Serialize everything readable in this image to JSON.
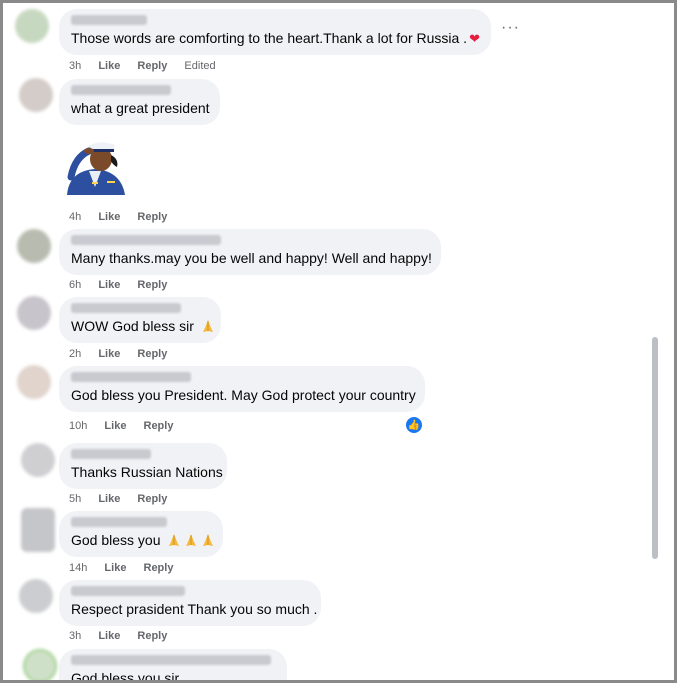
{
  "comments": [
    {
      "text": "Those words are comforting to the heart.Thank a lot for Russia .",
      "emoji": "heart",
      "time": "3h",
      "like": "Like",
      "reply": "Reply",
      "edited": "Edited"
    },
    {
      "text": "what a great president",
      "time": "4h",
      "like": "Like",
      "reply": "Reply",
      "sticker": "saluting-officer-sticker"
    },
    {
      "text": "Many thanks.may you be well and happy! Well and happy!",
      "time": "6h",
      "like": "Like",
      "reply": "Reply"
    },
    {
      "text": "WOW God bless sir",
      "emoji": "praying-hands",
      "time": "2h",
      "like": "Like",
      "reply": "Reply"
    },
    {
      "text": "God bless you President. May God protect your country",
      "time": "10h",
      "like": "Like",
      "reply": "Reply",
      "reaction": "like-reaction-icon"
    },
    {
      "text": "Thanks Russian Nations",
      "time": "5h",
      "like": "Like",
      "reply": "Reply"
    },
    {
      "text": "God bless you",
      "emoji": "praying-hands x3",
      "time": "14h",
      "like": "Like",
      "reply": "Reply"
    },
    {
      "text": "Respect prasident Thank you so much .",
      "time": "3h",
      "like": "Like",
      "reply": "Reply"
    },
    {
      "text": "God bless you sir"
    }
  ],
  "more_options": "···",
  "colors": {
    "bubble": "#f0f2f5",
    "meta": "#65676b",
    "like_blue": "#1877f2",
    "heart": "#e41e3f"
  }
}
